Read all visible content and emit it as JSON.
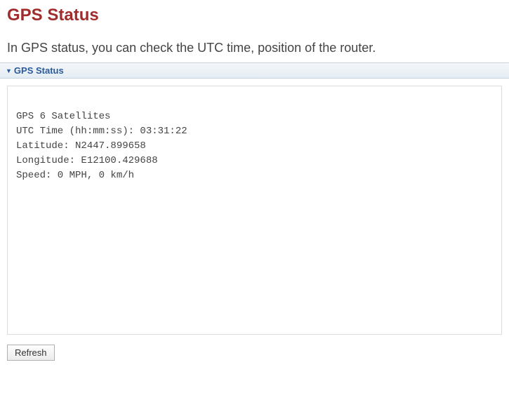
{
  "page": {
    "title": "GPS Status",
    "intro": "In GPS status, you can check the UTC time, position of the router."
  },
  "panel": {
    "header": "GPS Status"
  },
  "gps": {
    "satellites_line": "GPS 6 Satellites",
    "utc_line": "UTC Time (hh:mm:ss): 03:31:22",
    "latitude_line": "Latitude: N2447.899658",
    "longitude_line": "Longitude: E12100.429688",
    "speed_line": "Speed: 0 MPH, 0 km/h"
  },
  "buttons": {
    "refresh": "Refresh"
  }
}
